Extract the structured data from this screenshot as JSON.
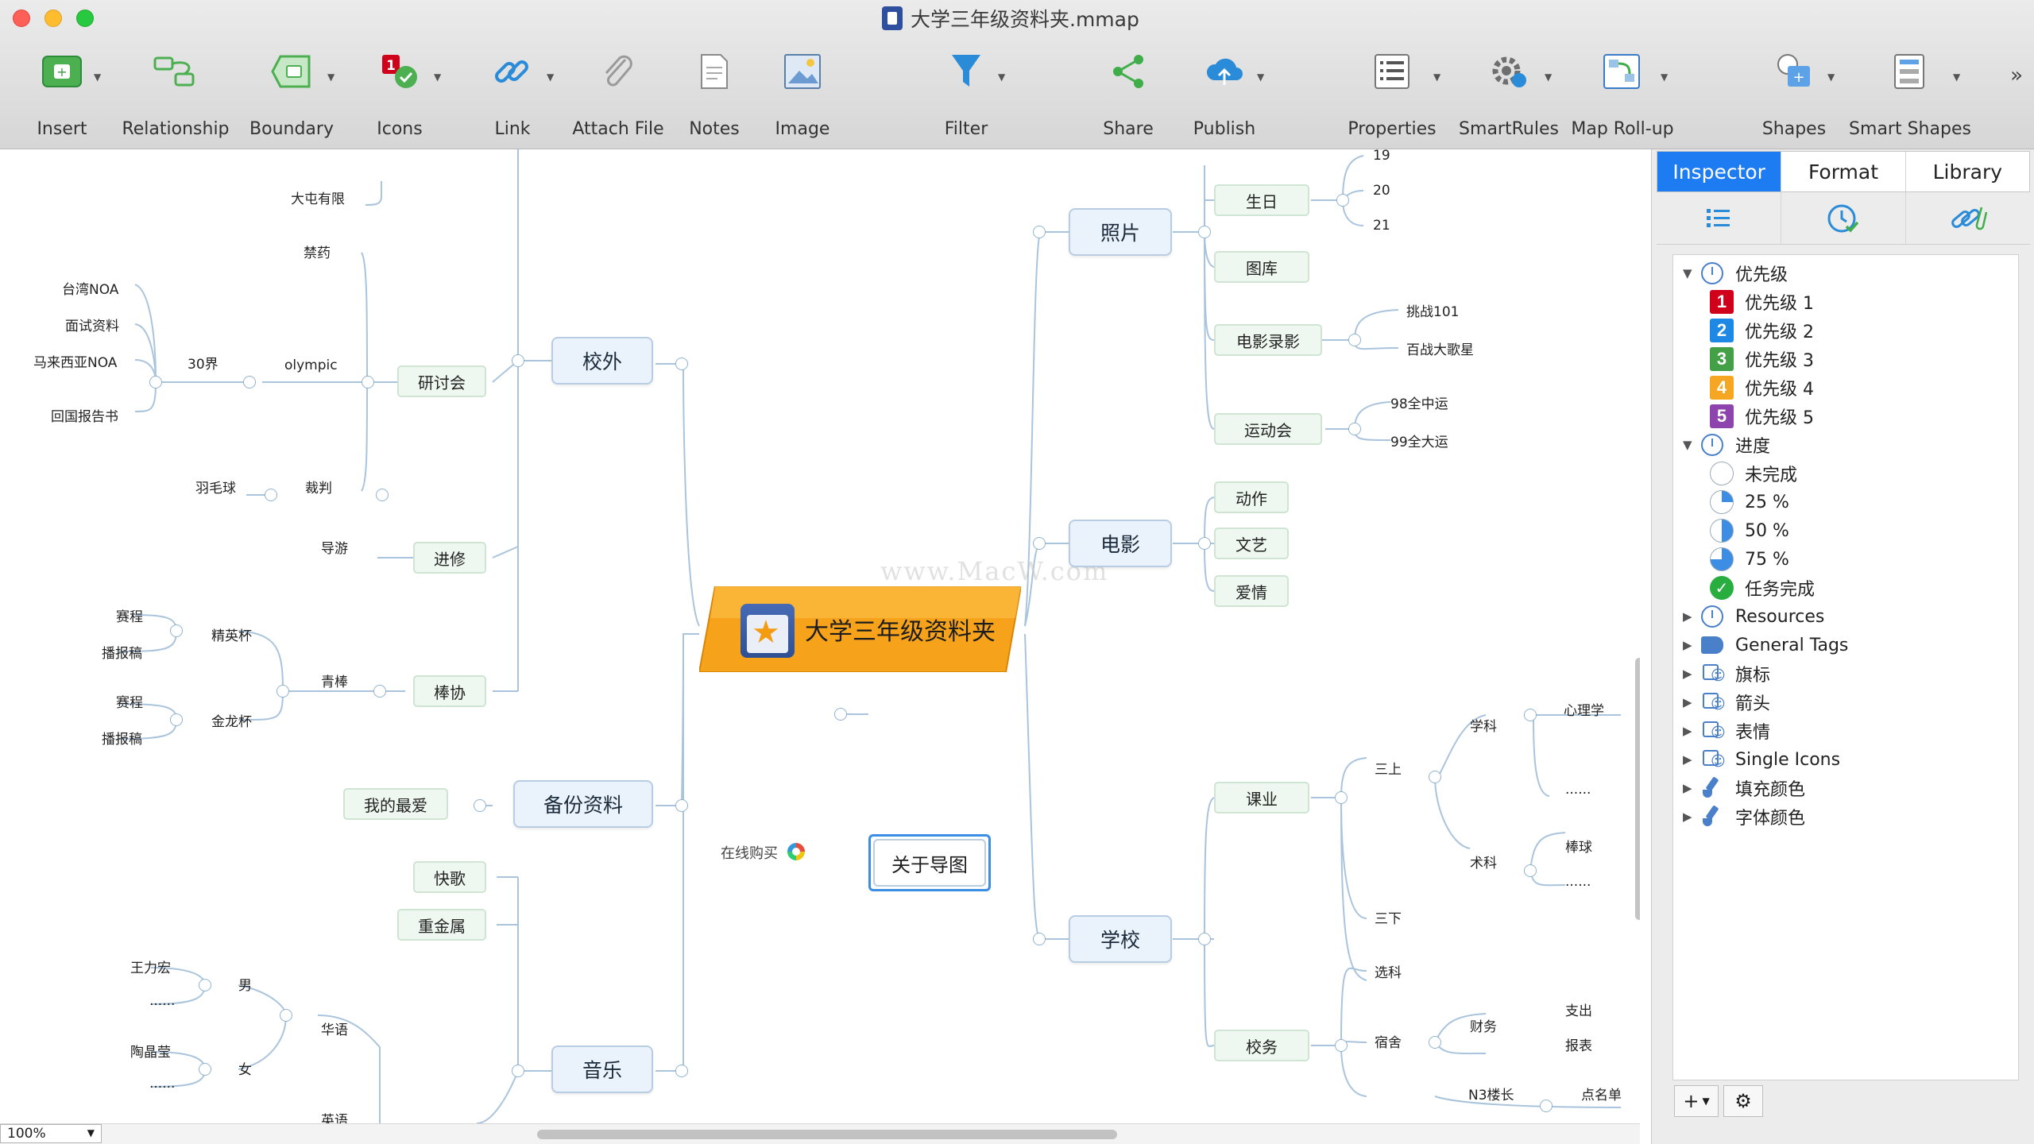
{
  "window": {
    "title": "大学三年级资料夹.mmap"
  },
  "toolbar": {
    "insert": "Insert",
    "relationship": "Relationship",
    "boundary": "Boundary",
    "icons": "Icons",
    "link": "Link",
    "attach": "Attach File",
    "notes": "Notes",
    "image": "Image",
    "filter": "Filter",
    "share": "Share",
    "publish": "Publish",
    "properties": "Properties",
    "smartrules": "SmartRules",
    "rollup": "Map Roll-up",
    "shapes": "Shapes",
    "smartshapes": "Smart Shapes",
    "overflow": "»",
    "accent": "#2a8bd8",
    "green": "#3fae49"
  },
  "map": {
    "central": "大学三年级资料夹",
    "about": "关于导图",
    "buy": "在线购买",
    "watermark": "www.MacW.com",
    "left": {
      "xiaowai": "校外",
      "backup": "备份资料",
      "music": "音乐",
      "yantaohui": "研讨会",
      "jinxiu": "进修",
      "bangxie": "棒协",
      "favorite": "我的最爱",
      "kuaige": "快歌",
      "zhongjinshu": "重金属",
      "datun": "大屯有限",
      "jinyao": "禁药",
      "olympic": "olympic",
      "caipan": "裁判",
      "sanshijie": "30界",
      "taiwan": "台湾NOA",
      "mianshi": "面试资料",
      "malai": "马来西亚NOA",
      "huiguo": "回国报告书",
      "yumaoqiu": "羽毛球",
      "daoyou": "导游",
      "qingbang": "青棒",
      "jingying": "精英杯",
      "jinlong": "金龙杯",
      "saicheng1": "赛程",
      "bobao1": "播报稿",
      "saicheng2": "赛程",
      "bobao2": "播报稿",
      "huayu": "华语",
      "nan": "男",
      "nv": "女",
      "wanglihong": "王力宏",
      "dots1": "......",
      "taojingying": "陶晶莹",
      "dots2": "......",
      "yingyu": "英语"
    },
    "right": {
      "photos": "照片",
      "movies": "电影",
      "school": "学校",
      "birthday": "生日",
      "gallery": "图库",
      "filming": "电影录影",
      "sportsmeet": "运动会",
      "d19": "19",
      "d20": "20",
      "d21": "21",
      "tiaozhan": "挑战101",
      "baizhan": "百战大歌星",
      "zhongyun": "98全中运",
      "dayun": "99全大运",
      "action": "动作",
      "art": "文艺",
      "romance": "爱情",
      "course": "课业",
      "affairs": "校务",
      "sanshang": "三上",
      "sanxia": "三下",
      "xueke": "学科",
      "shuke": "术科",
      "psych": "心理学",
      "dots3": "......",
      "baseball": "棒球",
      "dots4": "......",
      "xuanke": "选科",
      "sushe": "宿舍",
      "caiwu": "财务",
      "zhichu": "支出",
      "baobiao": "报表",
      "n3": "N3楼长",
      "dianming": "点名单"
    }
  },
  "statusbar": {
    "zoom": "100%"
  },
  "inspector": {
    "tabs": [
      "Inspector",
      "Format",
      "Library"
    ],
    "accent": "#1e7cf3",
    "priority_group": "优先级",
    "priorities": [
      {
        "n": "1",
        "label": "优先级 1",
        "color": "#d0021b"
      },
      {
        "n": "2",
        "label": "优先级 2",
        "color": "#1e88e5"
      },
      {
        "n": "3",
        "label": "优先级 3",
        "color": "#43a047"
      },
      {
        "n": "4",
        "label": "优先级 4",
        "color": "#f5a623"
      },
      {
        "n": "5",
        "label": "优先级 5",
        "color": "#8e44ad"
      }
    ],
    "progress_group": "进度",
    "progress": [
      {
        "label": "未完成",
        "pct": 0
      },
      {
        "label": "25 %",
        "pct": 25
      },
      {
        "label": "50 %",
        "pct": 50
      },
      {
        "label": "75 %",
        "pct": 75
      },
      {
        "label": "任务完成",
        "pct": 100
      }
    ],
    "groups": [
      "Resources",
      "General Tags",
      "旗标",
      "箭头",
      "表情",
      "Single Icons",
      "填充颜色",
      "字体颜色"
    ],
    "add": "+",
    "settings": "⚙"
  }
}
